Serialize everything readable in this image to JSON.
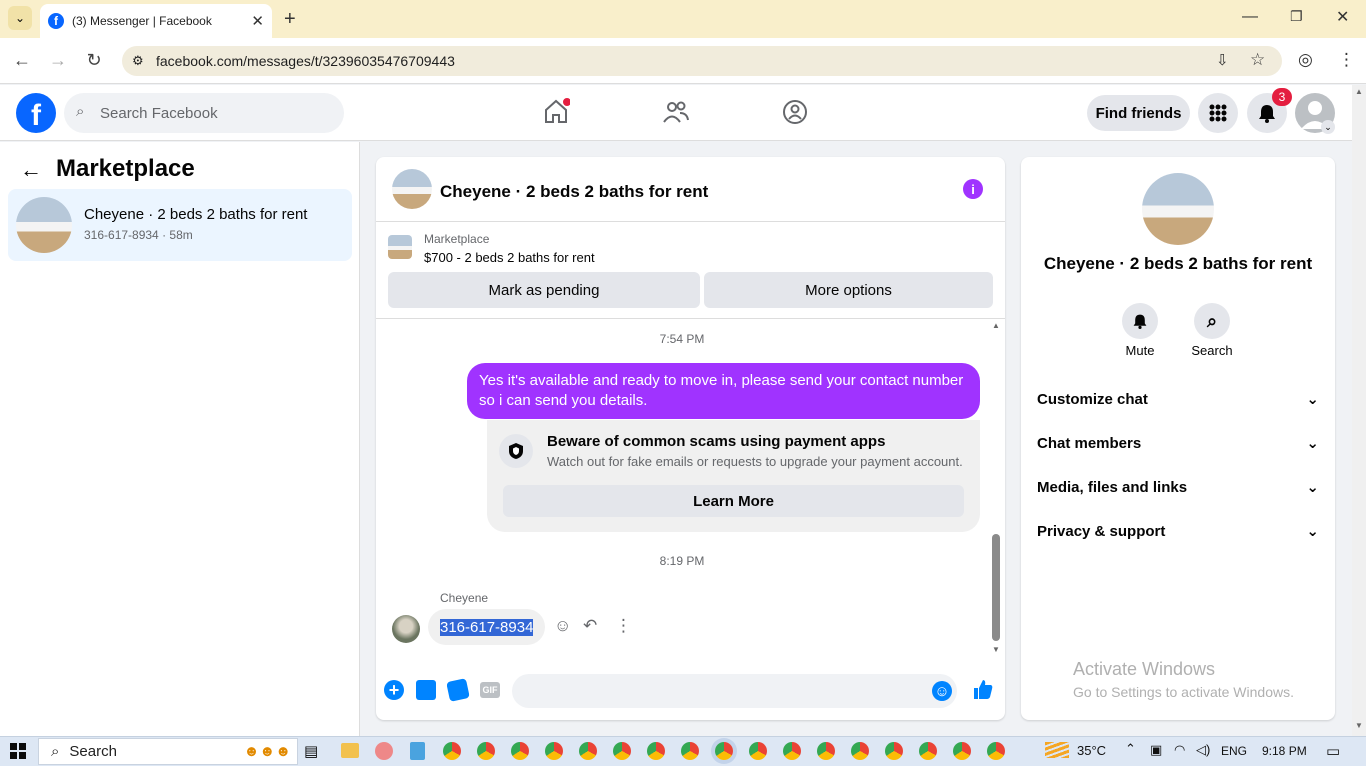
{
  "browser": {
    "tab_title": "(3) Messenger | Facebook",
    "url": "facebook.com/messages/t/32396035476709443"
  },
  "header": {
    "search_placeholder": "Search Facebook",
    "find_friends": "Find friends",
    "notification_count": "3"
  },
  "left": {
    "title": "Marketplace",
    "thread": {
      "name": "Cheyene · 2 beds 2 baths for rent",
      "preview": "316-617-8934 · 58m"
    }
  },
  "chat": {
    "title": "Cheyene · 2 beds 2 baths for rent",
    "listing_label": "Marketplace",
    "listing_text": "$700 - 2 beds 2 baths for rent",
    "mark_pending": "Mark as pending",
    "more_options": "More options",
    "time1": "7:54 PM",
    "outgoing": "Yes it's available and ready to move in, please send your contact number so i can send you details.",
    "scam_title": "Beware of common scams using payment apps",
    "scam_text": "Watch out for fake emails or requests to upgrade your payment account.",
    "learn_more": "Learn More",
    "time2": "8:19 PM",
    "sender": "Cheyene",
    "incoming": "316-617-8934"
  },
  "details": {
    "name": "Cheyene · 2 beds 2 baths for rent",
    "mute": "Mute",
    "search": "Search",
    "sections": [
      "Customize chat",
      "Chat members",
      "Media, files and links",
      "Privacy & support"
    ]
  },
  "watermark": {
    "line1": "Activate Windows",
    "line2": "Go to Settings to activate Windows."
  },
  "taskbar": {
    "search": "Search",
    "weather": "35°C",
    "lang": "ENG",
    "time": "9:18 PM"
  },
  "colors": {
    "fb_blue": "#0866ff",
    "purple": "#a033ff",
    "messenger_blue": "#0084ff"
  }
}
